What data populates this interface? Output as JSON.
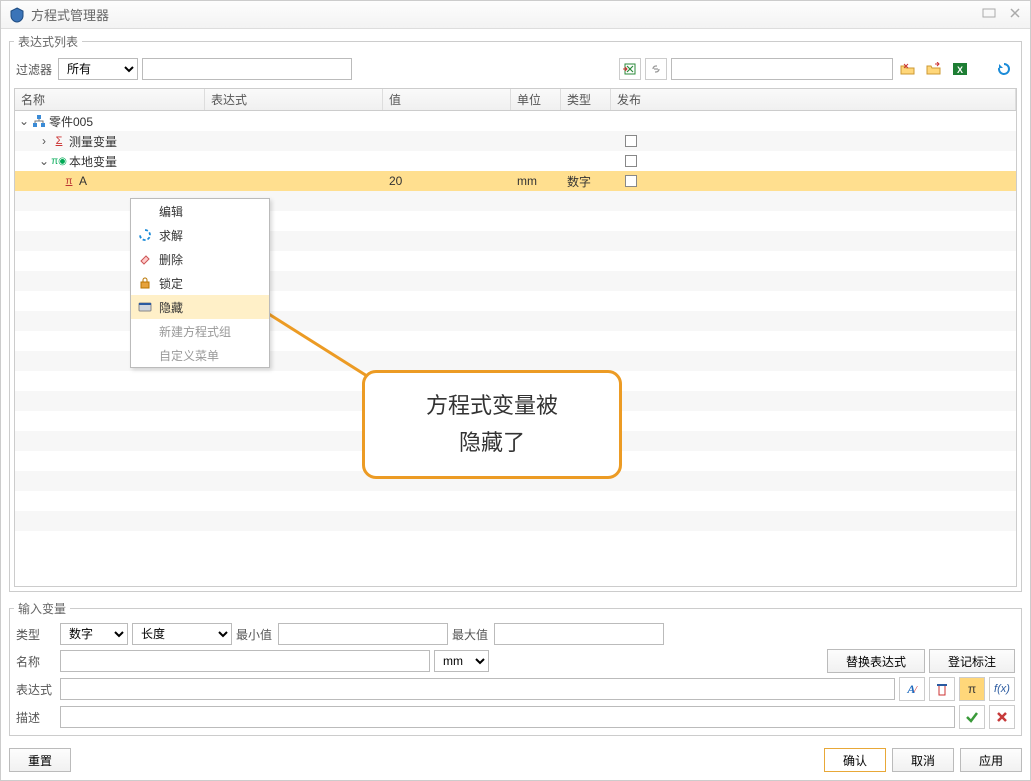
{
  "window": {
    "title": "方程式管理器"
  },
  "group_top": {
    "legend": "表达式列表"
  },
  "filter": {
    "label": "过滤器",
    "select": {
      "value": "所有"
    }
  },
  "columns": {
    "name": "名称",
    "expr": "表达式",
    "value": "值",
    "unit": "单位",
    "type": "类型",
    "pub": "发布"
  },
  "tree": {
    "root": {
      "label": "零件005"
    },
    "measure": {
      "label": "测量变量"
    },
    "local": {
      "label": "本地变量"
    },
    "varA": {
      "name": "A",
      "value": "20",
      "unit": "mm",
      "type": "数字"
    }
  },
  "context_menu": {
    "edit": "编辑",
    "solve": "求解",
    "delete": "删除",
    "lock": "锁定",
    "hide": "隐藏",
    "new_group": "新建方程式组",
    "custom_menu": "自定义菜单"
  },
  "callout": {
    "line1": "方程式变量被",
    "line2": "隐藏了"
  },
  "group_bottom": {
    "legend": "输入变量"
  },
  "input_form": {
    "type_label": "类型",
    "type_value": "数字",
    "dim_value": "长度",
    "min_label": "最小值",
    "max_label": "最大值",
    "name_label": "名称",
    "unit_value": "mm",
    "expr_label": "表达式",
    "desc_label": "描述",
    "replace_btn": "替换表达式",
    "register_btn": "登记标注"
  },
  "buttons": {
    "reset": "重置",
    "ok": "确认",
    "cancel": "取消",
    "apply": "应用"
  }
}
